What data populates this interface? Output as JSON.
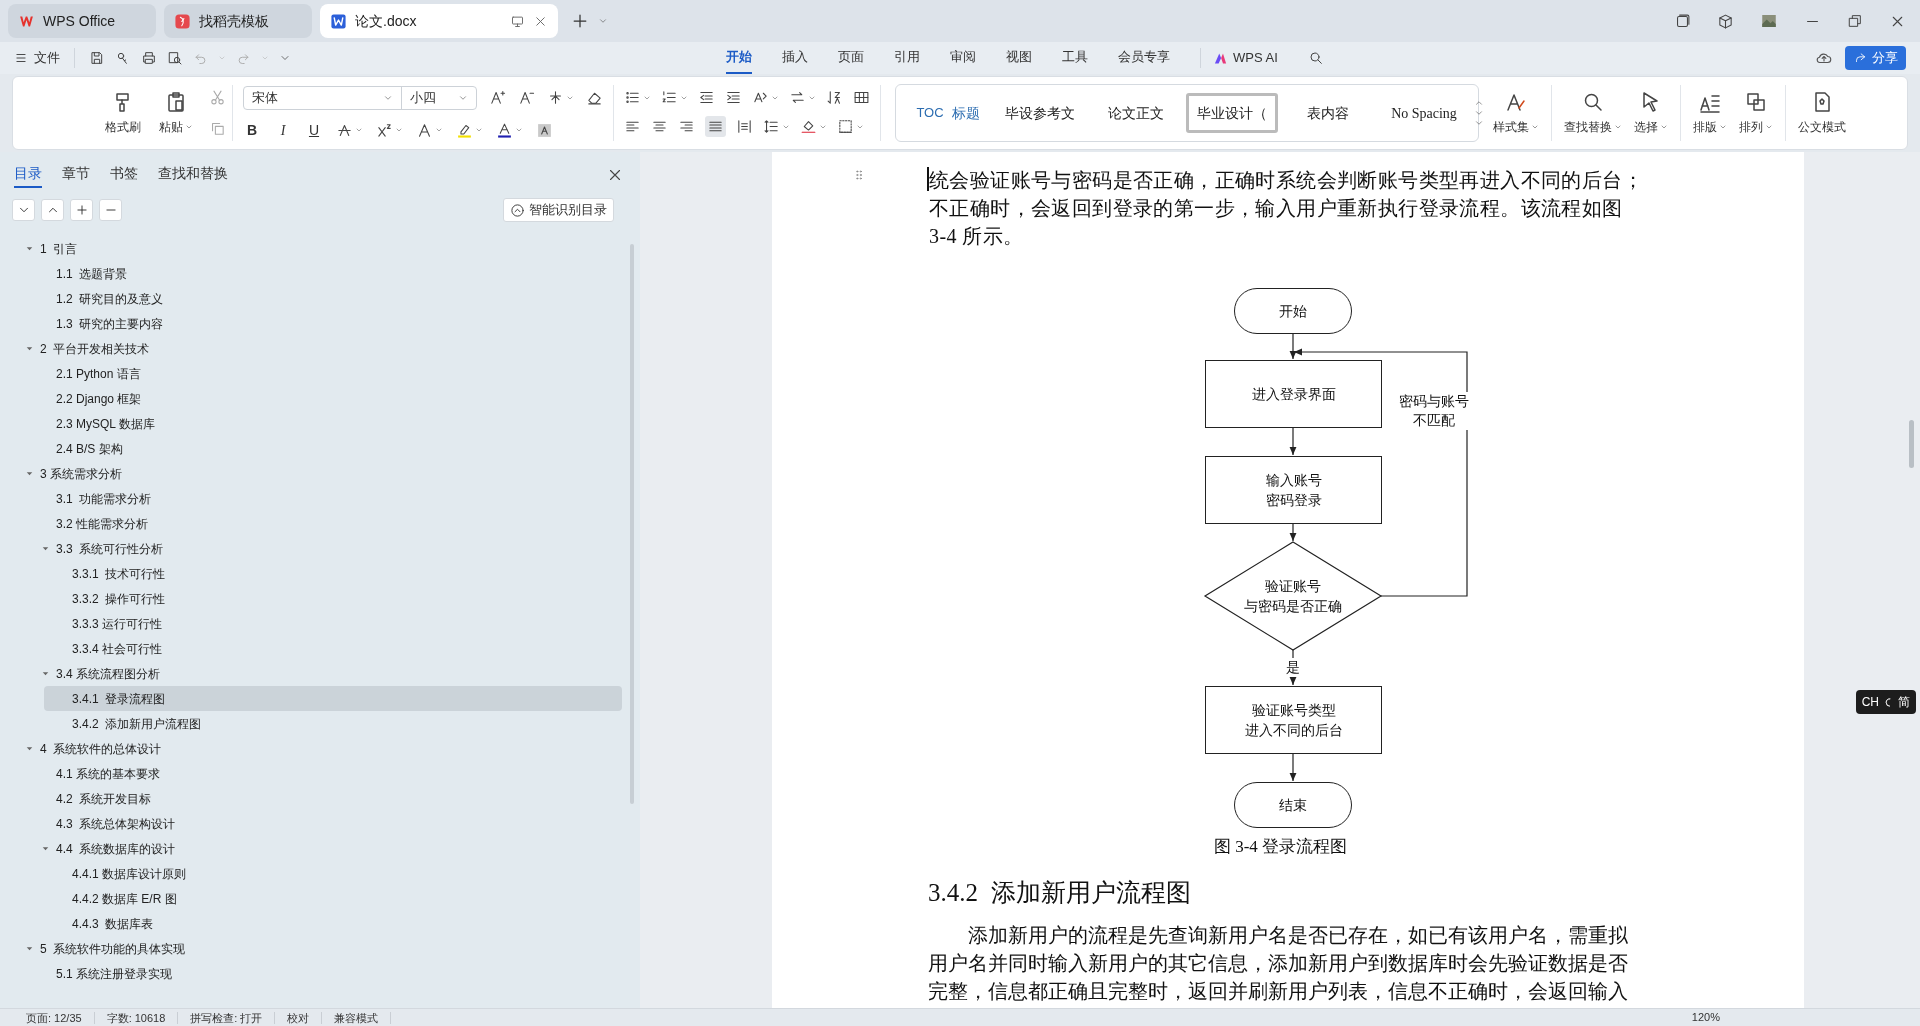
{
  "app_tabs": [
    {
      "kind": "home",
      "label": "WPS Office",
      "selected": false
    },
    {
      "kind": "template",
      "label": "找稻壳模板",
      "selected": false
    },
    {
      "kind": "doc",
      "label": "论文.docx",
      "selected": true
    }
  ],
  "file_menu": "文件",
  "ribbon_tabs": [
    {
      "label": "开始",
      "selected": true
    },
    {
      "label": "插入",
      "selected": false
    },
    {
      "label": "页面",
      "selected": false
    },
    {
      "label": "引用",
      "selected": false
    },
    {
      "label": "审阅",
      "selected": false
    },
    {
      "label": "视图",
      "selected": false
    },
    {
      "label": "工具",
      "selected": false
    },
    {
      "label": "会员专享",
      "selected": false
    }
  ],
  "ai_label": "WPS AI",
  "share_button": "分享",
  "ribbon": {
    "format_painter": "格式刷",
    "paste": "粘贴",
    "font": "宋体",
    "font_size": "小四",
    "format_buttons": [
      "B",
      "I",
      "U"
    ],
    "styles": [
      {
        "prefix": "TOC",
        "label": "标题",
        "selected": false
      },
      {
        "label": "毕设参考文",
        "selected": false
      },
      {
        "label": "论文正文",
        "selected": false
      },
      {
        "label": "毕业设计（",
        "selected": true
      },
      {
        "label": "表内容",
        "selected": false
      },
      {
        "label": "No Spacing",
        "selected": false
      }
    ],
    "style_set": "样式集",
    "find_replace": "查找替换",
    "select": "选择",
    "layout": "排版",
    "arrange": "排列",
    "official_mode": "公文模式"
  },
  "nav_panel": {
    "tabs": [
      {
        "label": "目录",
        "selected": true
      },
      {
        "label": "章节",
        "selected": false
      },
      {
        "label": "书签",
        "selected": false
      },
      {
        "label": "查找和替换",
        "selected": false
      }
    ],
    "smart_toc_button": "智能识别目录",
    "items": [
      {
        "label": "1  引言",
        "expanded": true,
        "selected": false,
        "children": [
          {
            "label": "1.1  选题背景",
            "selected": false
          },
          {
            "label": "1.2  研究目的及意义",
            "selected": false
          },
          {
            "label": "1.3  研究的主要内容",
            "selected": false
          }
        ]
      },
      {
        "label": "2  平台开发相关技术",
        "expanded": true,
        "selected": false,
        "children": [
          {
            "label": "2.1 Python 语言",
            "selected": false
          },
          {
            "label": "2.2 Django 框架",
            "selected": false
          },
          {
            "label": "2.3 MySQL 数据库",
            "selected": false
          },
          {
            "label": "2.4 B/S 架构",
            "selected": false
          }
        ]
      },
      {
        "label": "3 系统需求分析",
        "expanded": true,
        "selected": false,
        "children": [
          {
            "label": "3.1  功能需求分析",
            "selected": false
          },
          {
            "label": "3.2 性能需求分析",
            "selected": false
          },
          {
            "label": "3.3  系统可行性分析",
            "expanded": true,
            "selected": false,
            "children": [
              {
                "label": "3.3.1  技术可行性",
                "selected": false
              },
              {
                "label": "3.3.2  操作可行性",
                "selected": false
              },
              {
                "label": "3.3.3 运行可行性",
                "selected": false
              },
              {
                "label": "3.3.4 社会可行性",
                "selected": false
              }
            ]
          },
          {
            "label": "3.4 系统流程图分析",
            "expanded": true,
            "selected": false,
            "children": [
              {
                "label": "3.4.1  登录流程图",
                "selected": true
              },
              {
                "label": "3.4.2  添加新用户流程图",
                "selected": false
              }
            ]
          }
        ]
      },
      {
        "label": "4  系统软件的总体设计",
        "expanded": true,
        "selected": false,
        "children": [
          {
            "label": "4.1 系统的基本要求",
            "selected": false
          },
          {
            "label": "4.2  系统开发目标",
            "selected": false
          },
          {
            "label": "4.3  系统总体架构设计",
            "selected": false
          },
          {
            "label": "4.4  系统数据库的设计",
            "expanded": true,
            "selected": false,
            "children": [
              {
                "label": "4.4.1 数据库设计原则",
                "selected": false
              },
              {
                "label": "4.4.2 数据库 E/R 图",
                "selected": false
              },
              {
                "label": "4.4.3  数据库表",
                "selected": false
              }
            ]
          }
        ]
      },
      {
        "label": "5  系统软件功能的具体实现",
        "expanded": true,
        "selected": false,
        "children": [
          {
            "label": "5.1 系统注册登录实现",
            "selected": false
          }
        ]
      }
    ]
  },
  "document": {
    "paragraph_1": "统会验证账号与密码是否正确，正确时系统会判断账号类型再进入不同的后台；不正确时，会返回到登录的第一步，输入用户重新执行登录流程。该流程如图 3-4 所示。",
    "flowchart": {
      "nodes": [
        {
          "kind": "terminal",
          "label": "开始"
        },
        {
          "kind": "process",
          "label": "进入登录界面"
        },
        {
          "kind": "process",
          "lines": [
            "输入账号",
            "密码登录"
          ]
        },
        {
          "kind": "decision",
          "lines": [
            "验证账号",
            "与密码是否正确"
          ]
        },
        {
          "kind": "process",
          "lines": [
            "验证账号类型",
            "进入不同的后台"
          ]
        },
        {
          "kind": "terminal",
          "label": "结束"
        }
      ],
      "edge_labels": [
        {
          "lines": [
            "密码与账号",
            "不匹配"
          ]
        },
        {
          "lines": [
            "是"
          ]
        }
      ]
    },
    "caption": "图 3-4 登录流程图",
    "heading": "3.4.2  添加新用户流程图",
    "paragraph_2": "添加新用户的流程是先查询新用户名是否已存在，如已有该用户名，需重拟用户名并同时输入新用户的其它信息，添加新用户到数据库时会先验证数据是否完整，信息都正确且完整时，返回并刷新用户列表，信息不正确时，会返回输入"
  },
  "ime_indicator": {
    "language": "CH",
    "mode": "简"
  },
  "status_bar": [
    "页面: 12/35",
    "字数: 10618",
    "拼写检查: 打开",
    "校对",
    "兼容模式"
  ],
  "zoom_level": "120%"
}
